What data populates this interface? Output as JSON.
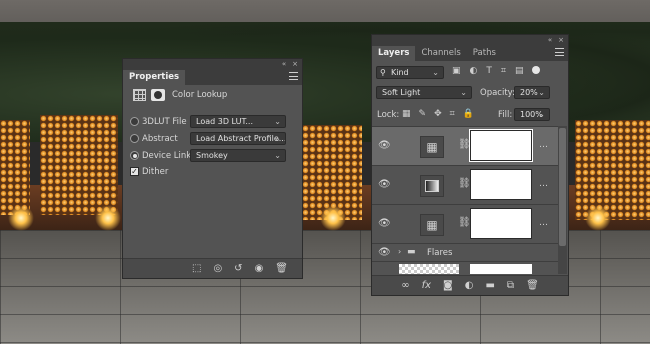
{
  "background": {
    "scene": "Marquee letters at night"
  },
  "properties": {
    "title": "Properties",
    "adjustment_name": "Color Lookup",
    "rows": [
      {
        "label": "3DLUT File",
        "value": "Load 3D LUT...",
        "selected": false
      },
      {
        "label": "Abstract",
        "value": "Load Abstract Profile...",
        "selected": false
      },
      {
        "label": "Device Link",
        "value": "Smokey",
        "selected": true
      }
    ],
    "dither_label": "Dither",
    "dither_checked": true,
    "collapse_glyph": "«",
    "close_glyph": "×",
    "bottom_icons": [
      "clip-to-layer-icon",
      "view-previous-icon",
      "reset-icon",
      "visibility-icon",
      "trash-icon"
    ]
  },
  "layers": {
    "tabs": [
      "Layers",
      "Channels",
      "Paths"
    ],
    "active_tab": "Layers",
    "filter_kind": "Kind",
    "blend_mode": "Soft Light",
    "opacity_label": "Opacity:",
    "opacity_value": "20%",
    "lock_label": "Lock:",
    "fill_label": "Fill:",
    "fill_value": "100%",
    "items": [
      {
        "type": "color-lookup",
        "selected": true
      },
      {
        "type": "gradient-map",
        "selected": false
      },
      {
        "type": "color-lookup",
        "selected": false
      }
    ],
    "group_name": "Flares",
    "footer_icons": [
      "link-icon",
      "fx-icon",
      "mask-icon",
      "adjustment-icon",
      "folder-icon",
      "new-layer-icon",
      "trash-icon"
    ]
  },
  "colors": {
    "panel_bg": "#535353",
    "selected_row": "#6a6a6a",
    "accent": "#e6e6e6"
  }
}
